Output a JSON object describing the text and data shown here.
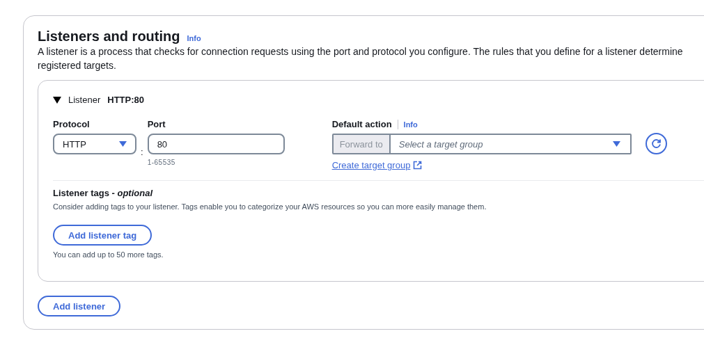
{
  "section": {
    "title": "Listeners and routing",
    "info": "Info",
    "description": [
      "A listener is a process that checks for connection requests using the port and protocol you configure. The rules that you define for a listener determine",
      "registered targets."
    ]
  },
  "listener": {
    "expanded": true,
    "label": "Listener",
    "name": "HTTP:80",
    "protocol": {
      "label": "Protocol",
      "value": "HTTP"
    },
    "separator": ":",
    "port": {
      "label": "Port",
      "value": "80",
      "hint": "1-65535"
    },
    "default_action": {
      "label": "Default action",
      "info": "Info",
      "prefix": "Forward to",
      "placeholder": "Select a target group",
      "link": "Create target group"
    },
    "tags": {
      "title": "Listener tags - *optional*",
      "description": "Consider adding tags to your listener. Tags enable you to categorize your AWS resources so you can more easily manage them.",
      "button": "Add listener tag",
      "note": "You can add up to 50 more tags."
    }
  },
  "add_listener": "Add listener"
}
